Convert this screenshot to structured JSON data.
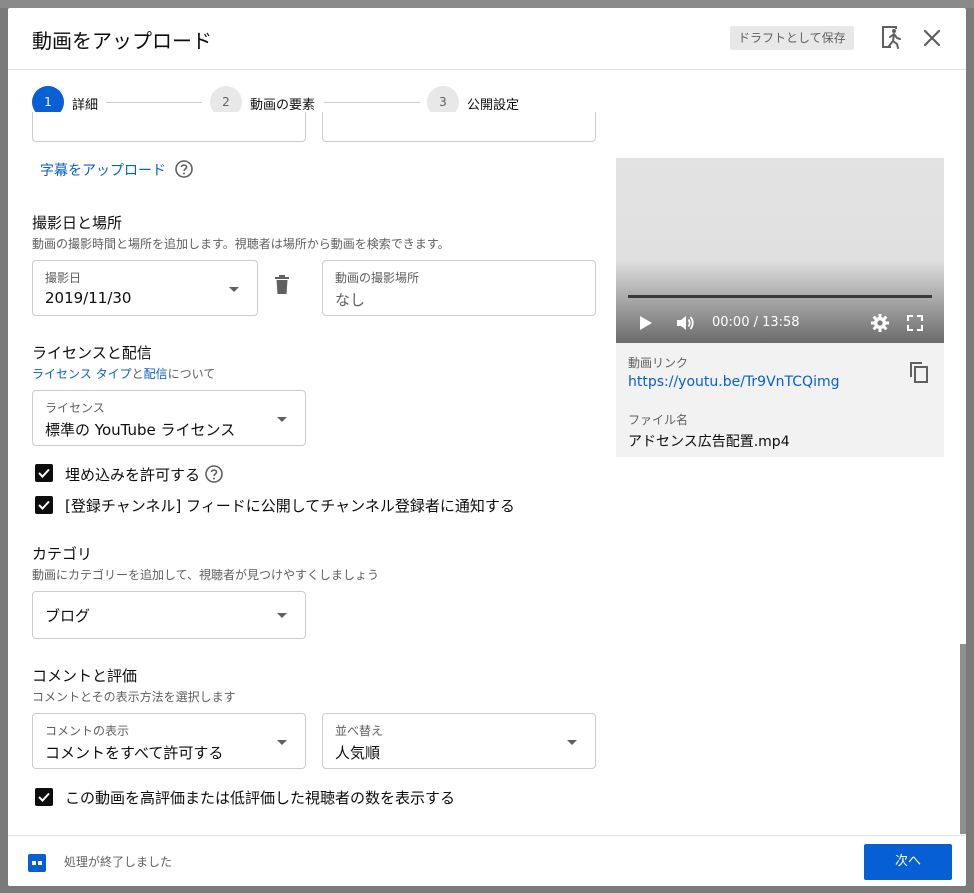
{
  "dialog": {
    "title": "動画をアップロード",
    "draft_label": "ドラフトとして保存",
    "exit_icon": "exit-icon",
    "close_icon": "close-icon"
  },
  "stepper": {
    "steps": [
      {
        "number": "1",
        "label": "詳細",
        "active": true
      },
      {
        "number": "2",
        "label": "動画の要素",
        "active": false
      },
      {
        "number": "3",
        "label": "公開設定",
        "active": false
      }
    ]
  },
  "subtitles": {
    "link": "字幕をアップロード"
  },
  "recording": {
    "title": "撮影日と場所",
    "description": "動画の撮影時間と場所を追加します。視聴者は場所から動画を検索できます。",
    "date_label": "撮影日",
    "date_value": "2019/11/30",
    "location_label": "動画の撮影場所",
    "location_value": "なし"
  },
  "license": {
    "title": "ライセンスと配信",
    "desc_link1": "ライセンス タイプ",
    "desc_mid": "と",
    "desc_link2": "配信",
    "desc_end": "について",
    "field_label": "ライセンス",
    "field_value": "標準の YouTube ライセンス",
    "allow_embed": "埋め込みを許可する",
    "notify_subscribers": "[登録チャンネル] フィードに公開してチャンネル登録者に通知する"
  },
  "category": {
    "title": "カテゴリ",
    "description": "動画にカテゴリーを追加して、視聴者が見つけやすくしましょう",
    "value": "ブログ"
  },
  "comments": {
    "title": "コメントと評価",
    "description": "コメントとその表示方法を選択します",
    "visibility_label": "コメントの表示",
    "visibility_value": "コメントをすべて許可する",
    "sort_label": "並べ替え",
    "sort_value": "人気順",
    "show_ratings": "この動画を高評価または低評価した視聴者の数を表示する"
  },
  "preview": {
    "time": "00:00 / 13:58",
    "link_label": "動画リンク",
    "link_value": "https://youtu.be/Tr9VnTCQimg",
    "filename_label": "ファイル名",
    "filename_value": "アドセンス広告配置.mp4"
  },
  "footer": {
    "status": "処理が終了しました",
    "next_label": "次へ"
  },
  "colors": {
    "accent": "#065fd4",
    "text": "#0d0d0d",
    "muted": "#606060"
  }
}
